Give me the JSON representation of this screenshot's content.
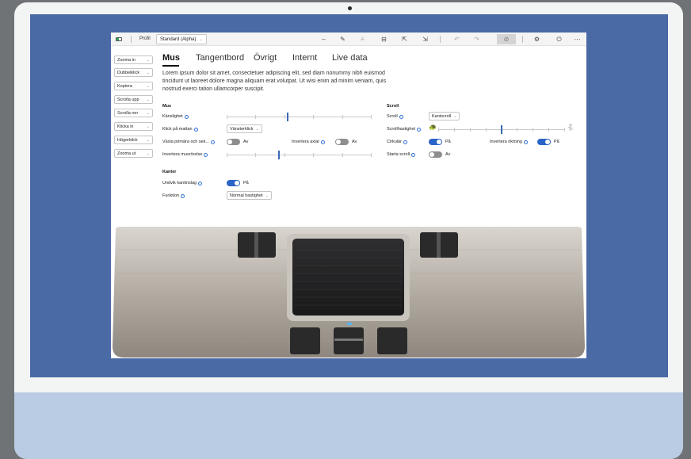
{
  "toolbar": {
    "profile_label": "Profil",
    "profile_value": "Standard (Alpha)",
    "icons": [
      "minus-icon",
      "pen-icon",
      "list-icon",
      "calibrate-icon",
      "pointer-icon",
      "move-icon",
      "undo-icon",
      "redo-icon",
      "stop-icon",
      "gear-icon",
      "power-icon",
      "more-icon"
    ]
  },
  "sidebar": {
    "buttons": [
      "Zooma in",
      "Dubbelklick",
      "Kopiera",
      "Scrolla upp",
      "Scrolla ner",
      "Klicka in",
      "Högerklick",
      "Zooma ut"
    ]
  },
  "tabs": [
    "Mus",
    "Tangentbord",
    "Övrigt",
    "Internt",
    "Live data"
  ],
  "intro": "Lorem ipsum dolor sit amet, consectetuer adipiscing elit, sed diam nonummy nibh euismod tincidunt ut laoreet dolore magna aliquam erat volutpat. Ut wisi enim ad minim veniam, quis nostrud exerci tation ullamcorper suscipit.",
  "mus": {
    "heading": "Mus",
    "sensitivity_label": "Känslighet",
    "sensitivity_value": 0.42,
    "click_label": "Klick på mattan",
    "click_value": "Vänsterklick",
    "swap_label": "Växla primära och sek...",
    "swap_value": "Av",
    "invert_axes_label": "Invertera axlar",
    "invert_axes_value": "Av",
    "invert_motion_label": "Invertera musrörelse",
    "invert_motion_value": 0.36
  },
  "scroll": {
    "heading": "Scroll",
    "scroll_label": "Scroll",
    "scroll_value": "Kantscroll",
    "speed_label": "Scrollhastighet",
    "speed_value": 0.5,
    "circular_label": "Cirkulär",
    "circular_value": "På",
    "invert_dir_label": "Invertera riktning",
    "invert_dir_value": "På",
    "start_label": "Starta scroll",
    "start_value": "Av"
  },
  "kanter": {
    "heading": "Kanter",
    "avoid_label": "Undvik kantinslag",
    "avoid_value": "På",
    "function_label": "Funktion",
    "function_value": "Normal hastighet"
  },
  "colors": {
    "accent": "#2b64c9",
    "screen_bg": "#4a6aa6",
    "chin": "#b9cce3"
  }
}
